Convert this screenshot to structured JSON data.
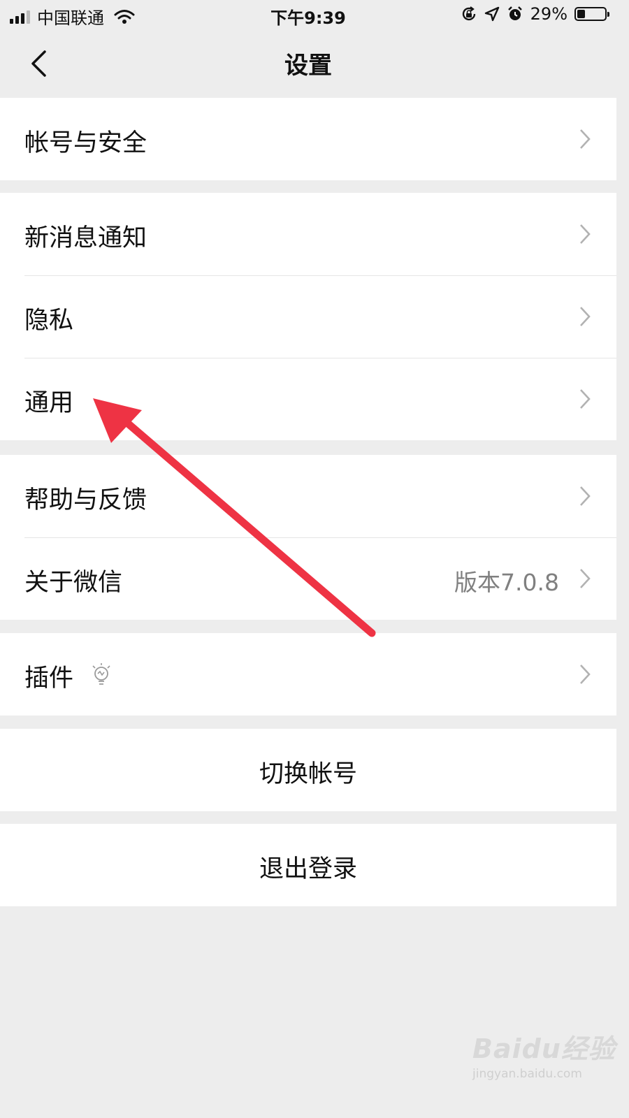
{
  "status_bar": {
    "carrier": "中国联通",
    "time": "下午9:39",
    "battery": "29%",
    "battery_level": 0.29,
    "icons": [
      "signal-icon",
      "wifi-icon",
      "orientation-lock-icon",
      "location-icon",
      "alarm-icon",
      "battery-icon"
    ]
  },
  "nav": {
    "title": "设置",
    "back_icon": "chevron-left-icon"
  },
  "groups": [
    {
      "items": [
        {
          "label": "帐号与安全"
        }
      ]
    },
    {
      "items": [
        {
          "label": "新消息通知"
        },
        {
          "label": "隐私"
        },
        {
          "label": "通用"
        }
      ]
    },
    {
      "items": [
        {
          "label": "帮助与反馈"
        },
        {
          "label": "关于微信",
          "value": "版本7.0.8"
        }
      ]
    },
    {
      "items": [
        {
          "label": "插件",
          "icon": "lightbulb-icon"
        }
      ]
    }
  ],
  "actions": {
    "switch_account": "切换帐号",
    "logout": "退出登录"
  },
  "annotation": {
    "color": "#ee3344",
    "points_to": "通用"
  },
  "watermark": {
    "text": "Baidu经验",
    "sub": "jingyan.baidu.com"
  }
}
